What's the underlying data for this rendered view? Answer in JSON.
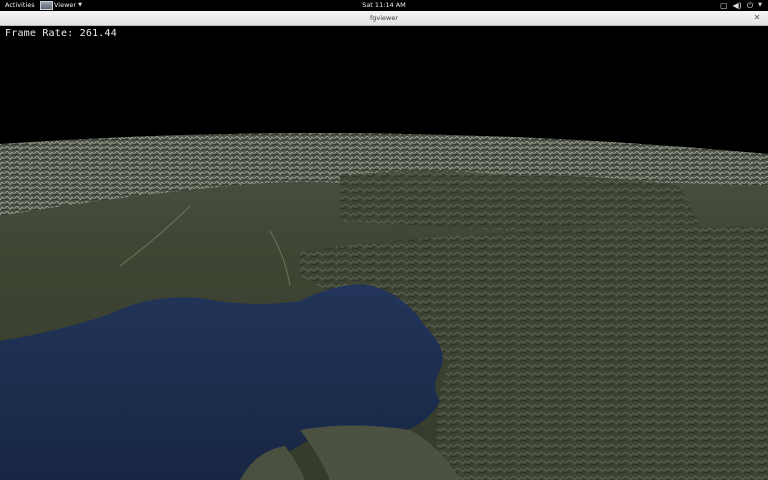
{
  "topbar": {
    "activities_label": "Activities",
    "app_name": "Viewer",
    "clock": "Sat 11:14 AM",
    "status_icons": [
      "screen-icon",
      "volume-icon",
      "power-icon"
    ]
  },
  "window": {
    "title": "fgviewer"
  },
  "overlay": {
    "frame_rate_text": "Frame Rate:  261.44"
  },
  "colors": {
    "sky": "#000000",
    "land": "#3d4431",
    "mountains": "#6d7263",
    "sea": "#1c2c4d",
    "coast_rock": "#4c5242"
  }
}
